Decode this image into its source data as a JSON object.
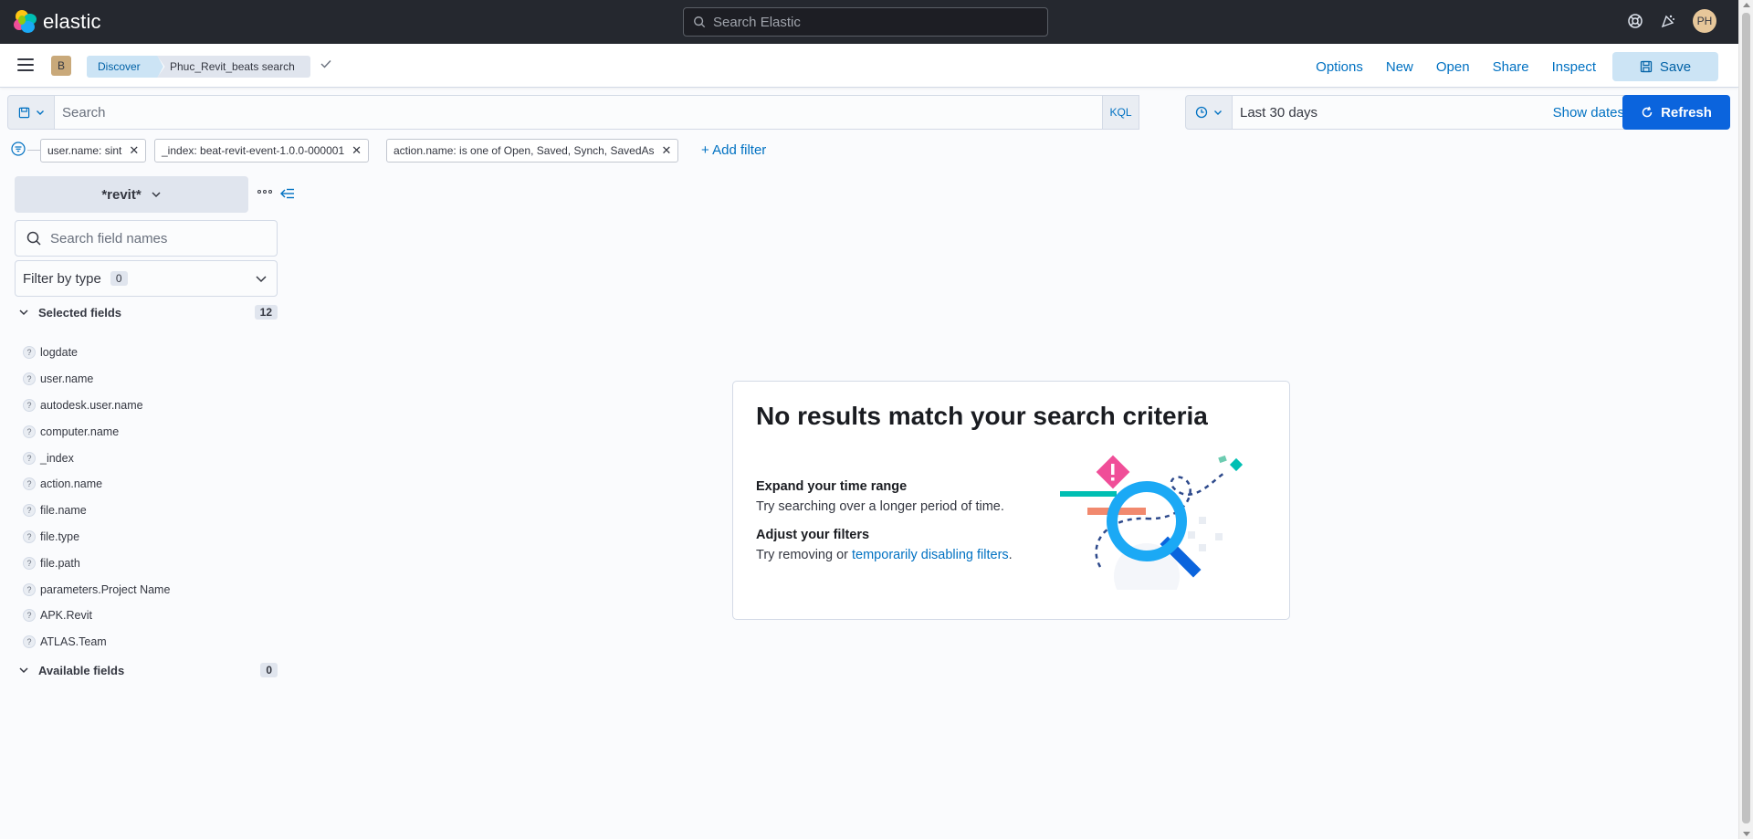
{
  "header": {
    "brand": "elastic",
    "search_placeholder": "Search Elastic",
    "avatar_initials": "PH",
    "icons": [
      "help-icon",
      "newsfeed-icon"
    ]
  },
  "appbar": {
    "space_initial": "B",
    "breadcrumbs": [
      "Discover",
      "Phuc_Revit_beats search"
    ],
    "links": {
      "options": "Options",
      "new": "New",
      "open": "Open",
      "share": "Share",
      "inspect": "Inspect"
    },
    "save_label": "Save"
  },
  "query_bar": {
    "placeholder": "Search",
    "language": "KQL",
    "date_range": "Last 30 days",
    "show_dates": "Show dates",
    "refresh_label": "Refresh"
  },
  "filters": {
    "pills": [
      "user.name: sint",
      "_index: beat-revit-event-1.0.0-000001",
      "action.name: is one of Open, Saved, Synch, SavedAs"
    ],
    "add_filter": "+ Add filter"
  },
  "sidebar": {
    "index_pattern": "*revit*",
    "field_search_placeholder": "Search field names",
    "filter_by_type": "Filter by type",
    "filter_by_type_count": "0",
    "selected_fields_label": "Selected fields",
    "selected_fields_count": "12",
    "selected_fields": [
      "logdate",
      "user.name",
      "autodesk.user.name",
      "computer.name",
      "_index",
      "action.name",
      "file.name",
      "file.type",
      "file.path",
      "parameters.Project Name",
      "APK.Revit",
      "ATLAS.Team"
    ],
    "available_fields_label": "Available fields",
    "available_fields_count": "0"
  },
  "empty_state": {
    "title": "No results match your search criteria",
    "tip1_title": "Expand your time range",
    "tip1_text": "Try searching over a longer period of time.",
    "tip2_title": "Adjust your filters",
    "tip2_text_prefix": "Try removing or ",
    "tip2_link": "temporarily disabling filters",
    "tip2_text_suffix": "."
  },
  "colors": {
    "header_bg": "#25282f",
    "primary": "#0b64dd",
    "link": "#0071c2",
    "save_bg": "#cce4f5"
  }
}
